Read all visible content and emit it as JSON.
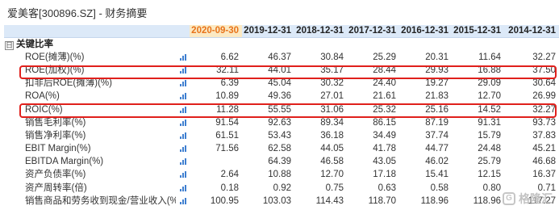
{
  "page": {
    "title": "爱美客[300896.SZ] - 财务摘要"
  },
  "table": {
    "periods": [
      "2020-09-30",
      "2019-12-31",
      "2018-12-31",
      "2017-12-31",
      "2016-12-31",
      "2015-12-31",
      "2014-12-31"
    ],
    "highlight_period": "2020-09-30",
    "section": {
      "toggle": "日",
      "label": "关键比率"
    },
    "rows": [
      {
        "label": "ROE(摊薄)(%)",
        "values": [
          "6.62",
          "46.37",
          "30.84",
          "25.29",
          "20.31",
          "11.64",
          "32.27"
        ]
      },
      {
        "label": "ROE(加权)(%)",
        "values": [
          "32.11",
          "44.01",
          "35.17",
          "28.44",
          "29.93",
          "16.88",
          "37.50"
        ],
        "boxed": true
      },
      {
        "label": "扣非后ROE(摊薄)(%)",
        "values": [
          "6.39",
          "45.04",
          "30.32",
          "24.40",
          "19.27",
          "29.09",
          "30.64"
        ]
      },
      {
        "label": "ROA(%)",
        "values": [
          "10.89",
          "49.36",
          "27.01",
          "21.61",
          "21.83",
          "12.70",
          "26.99"
        ]
      },
      {
        "label": "ROIC(%)",
        "values": [
          "11.28",
          "55.55",
          "31.06",
          "25.32",
          "25.16",
          "14.52",
          "32.27"
        ],
        "boxed": true
      },
      {
        "label": "销售毛利率(%)",
        "values": [
          "91.54",
          "92.63",
          "89.34",
          "86.15",
          "87.19",
          "91.31",
          "93.73"
        ]
      },
      {
        "label": "销售净利率(%)",
        "values": [
          "61.51",
          "53.43",
          "36.18",
          "34.49",
          "37.74",
          "15.79",
          "37.83"
        ]
      },
      {
        "label": "EBIT Margin(%)",
        "values": [
          "71.56",
          "62.58",
          "44.05",
          "41.78",
          "44.77",
          "24.48",
          "45.21"
        ]
      },
      {
        "label": "EBITDA Margin(%)",
        "values": [
          "",
          "64.39",
          "46.58",
          "43.05",
          "46.02",
          "25.79",
          "46.68"
        ]
      },
      {
        "label": "资产负债率(%)",
        "values": [
          "2.64",
          "10.88",
          "12.70",
          "17.18",
          "15.41",
          "12.15",
          "16.37"
        ]
      },
      {
        "label": "资产周转率(倍)",
        "values": [
          "0.18",
          "0.92",
          "0.75",
          "0.63",
          "0.58",
          "0.80",
          "0.71"
        ]
      },
      {
        "label": "销售商品和劳务收到现金/营业收入(%)",
        "values": [
          "100.95",
          "103.03",
          "114.43",
          "118.70",
          "118.96",
          "118.96",
          "117.27"
        ]
      }
    ]
  },
  "watermark": {
    "logo": "G",
    "text": "格隆汇"
  },
  "colors": {
    "header_bg": "#dce9f8",
    "highlight_text": "#e8731a",
    "highlight_bg": "#fbe9c3",
    "box_border": "#e0201c",
    "chart_icon": "#3f7fd0"
  }
}
